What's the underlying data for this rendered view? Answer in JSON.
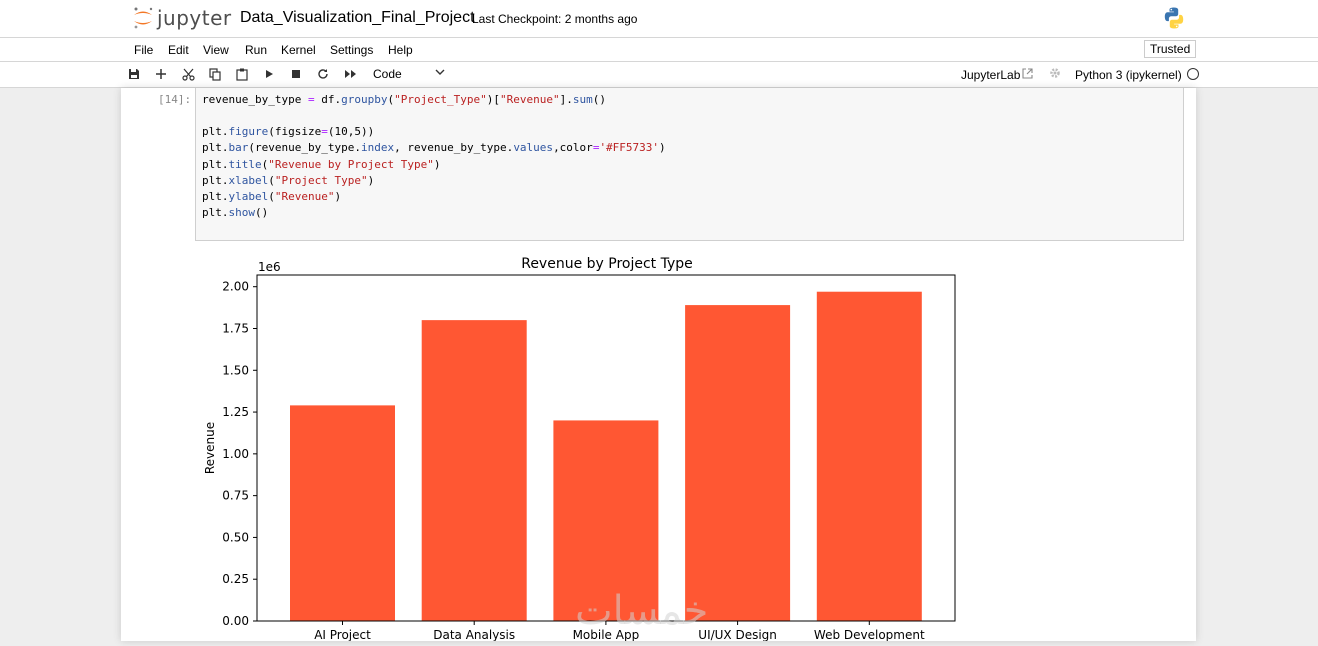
{
  "header": {
    "logo_text": "jupyter",
    "notebook_title": "Data_Visualization_Final_Project",
    "checkpoint": "Last Checkpoint: 2 months ago"
  },
  "menubar": {
    "items": [
      "File",
      "Edit",
      "View",
      "Run",
      "Kernel",
      "Settings",
      "Help"
    ],
    "trusted_label": "Trusted"
  },
  "toolbar": {
    "cell_type": "Code",
    "jupyterlab_link": "JupyterLab",
    "kernel_name": "Python 3 (ipykernel)"
  },
  "cell": {
    "prompt": "[14]:",
    "code_lines": [
      "revenue_by_type = df.groupby(\"Project_Type\")[\"Revenue\"].sum()",
      "",
      "plt.figure(figsize=(10,5))",
      "plt.bar(revenue_by_type.index, revenue_by_type.values,color='#FF5733')",
      "plt.title(\"Revenue by Project Type\")",
      "plt.xlabel(\"Project Type\")",
      "plt.ylabel(\"Revenue\")",
      "plt.show()"
    ]
  },
  "watermark_text": "خمسات",
  "chart_data": {
    "type": "bar",
    "title": "Revenue by Project Type",
    "ylabel": "Revenue",
    "offset_label": "1e6",
    "categories": [
      "AI Project",
      "Data Analysis",
      "Mobile App",
      "UI/UX Design",
      "Web Development"
    ],
    "values": [
      1.29,
      1.8,
      1.2,
      1.89,
      1.97
    ],
    "ylim": [
      0,
      2.07
    ],
    "yticks": [
      0.0,
      0.25,
      0.5,
      0.75,
      1.0,
      1.25,
      1.5,
      1.75,
      2.0
    ],
    "ytick_labels": [
      "0.00",
      "0.25",
      "0.50",
      "0.75",
      "1.00",
      "1.25",
      "1.50",
      "1.75",
      "2.00"
    ],
    "bar_color": "#FF5733",
    "grid": false
  }
}
